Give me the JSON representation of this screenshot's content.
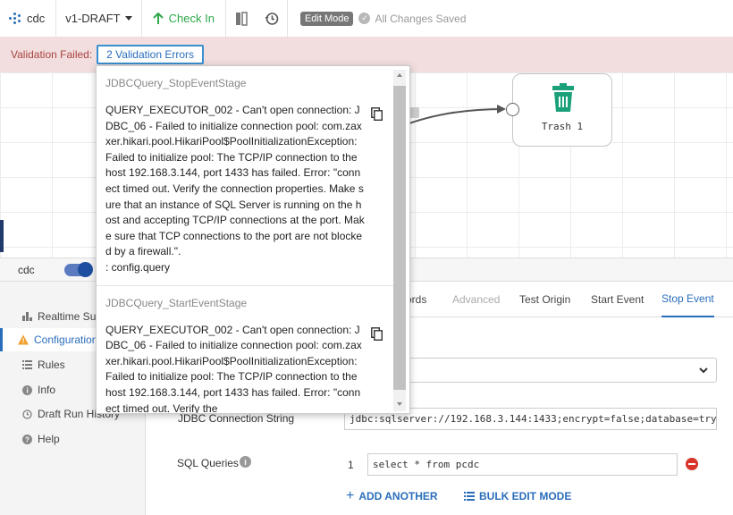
{
  "toolbar": {
    "pipeline_name": "cdc",
    "version": "v1-DRAFT",
    "check_in": "Check In",
    "edit_mode": "Edit Mode",
    "saved_status": "All Changes Saved"
  },
  "validation": {
    "label": "Validation Failed:",
    "errors_button": "2 Validation Errors"
  },
  "canvas": {
    "trash_node_label": "Trash 1"
  },
  "errors": [
    {
      "stage": "JDBCQuery_StopEventStage",
      "message": "QUERY_EXECUTOR_002 - Can't open connection: JDBC_06 - Failed to initialize connection pool: com.zaxxer.hikari.pool.HikariPool$PoolInitializationException: Failed to initialize pool: The TCP/IP connection to the host 192.168.3.144, port 1433 has failed. Error: \"connect timed out. Verify the connection properties. Make sure that an instance of SQL Server is running on the host and accepting TCP/IP connections at the port. Make sure that TCP connections to the port are not blocked by a firewall.\".",
      "config": ": config.query"
    },
    {
      "stage": "JDBCQuery_StartEventStage",
      "message": "QUERY_EXECUTOR_002 - Can't open connection: JDBC_06 - Failed to initialize connection pool: com.zaxxer.hikari.pool.HikariPool$PoolInitializationException: Failed to initialize pool: The TCP/IP connection to the host 192.168.3.144, port 1433 has failed. Error: \"connect timed out. Verify the"
    }
  ],
  "lower": {
    "pipeline_name": "cdc",
    "nav": [
      "Realtime Summary",
      "Configuration",
      "Rules",
      "Info",
      "Draft Run History",
      "Help"
    ],
    "tabs": [
      "ords",
      "Advanced",
      "Test Origin",
      "Start Event",
      "Stop Event"
    ]
  },
  "form": {
    "jdbc_label": "JDBC Connection String",
    "jdbc_value": "jdbc:sqlserver://192.168.3.144:1433;encrypt=false;database=try",
    "sql_label": "SQL Queries",
    "row_number": "1",
    "query_value": "select * from pcdc",
    "add_another": "ADD ANOTHER",
    "bulk_edit": "BULK EDIT MODE"
  },
  "colors": {
    "accent": "#2a6ebb",
    "check_in": "#2ea84a",
    "error_bg": "#f2dede",
    "error_text": "#a94442",
    "trash": "#1aa17a"
  }
}
